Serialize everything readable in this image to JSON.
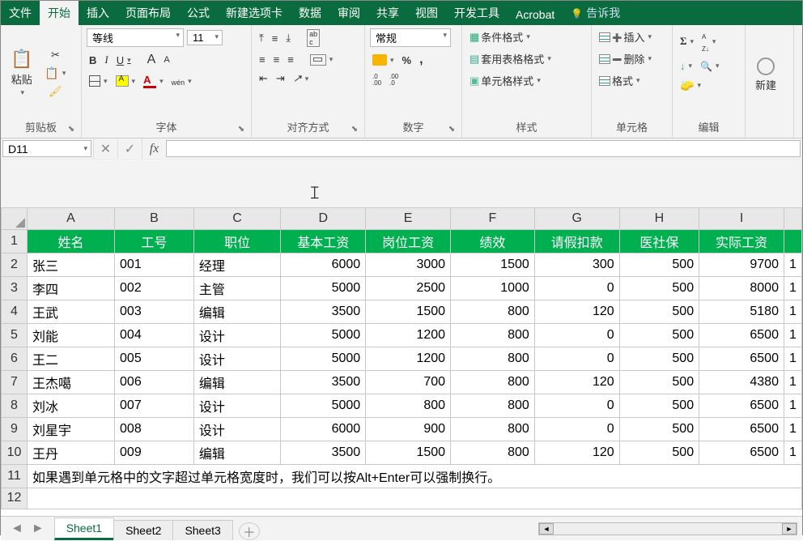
{
  "tabs": {
    "file": "文件",
    "home": "开始",
    "insert": "插入",
    "pagelayout": "页面布局",
    "formulas": "公式",
    "newtab": "新建选项卡",
    "data": "数据",
    "review": "审阅",
    "share": "共享",
    "view": "视图",
    "dev": "开发工具",
    "acrobat": "Acrobat",
    "tellme": "告诉我"
  },
  "ribbon": {
    "clipboard": {
      "label": "剪贴板",
      "paste": "粘贴"
    },
    "font": {
      "label": "字体",
      "name": "等线",
      "size": "11",
      "bold": "B",
      "italic": "I",
      "underline": "U",
      "grow": "A",
      "shrink": "A"
    },
    "align": {
      "label": "对齐方式"
    },
    "number": {
      "label": "数字",
      "format": "常规"
    },
    "styles": {
      "label": "样式",
      "cond": "条件格式",
      "table": "套用表格格式",
      "cell": "单元格样式"
    },
    "cells": {
      "label": "单元格",
      "insert": "插入",
      "delete": "删除",
      "format": "格式"
    },
    "editing": {
      "label": "编辑"
    },
    "newq": {
      "label": "新建"
    }
  },
  "namebox": "D11",
  "columns": {
    "A": "A",
    "B": "B",
    "C": "C",
    "D": "D",
    "E": "E",
    "F": "F",
    "G": "G",
    "H": "H",
    "I": "I"
  },
  "headers": {
    "name": "姓名",
    "id": "工号",
    "title": "职位",
    "base": "基本工资",
    "post": "岗位工资",
    "perf": "绩效",
    "leave": "请假扣款",
    "ins": "医社保",
    "net": "实际工资"
  },
  "rows": [
    {
      "n": "2",
      "name": "张三",
      "id": "001",
      "title": "经理",
      "base": "6000",
      "post": "3000",
      "perf": "1500",
      "leave": "300",
      "ins": "500",
      "net": "9700"
    },
    {
      "n": "3",
      "name": "李四",
      "id": "002",
      "title": "主管",
      "base": "5000",
      "post": "2500",
      "perf": "1000",
      "leave": "0",
      "ins": "500",
      "net": "8000"
    },
    {
      "n": "4",
      "name": "王武",
      "id": "003",
      "title": "编辑",
      "base": "3500",
      "post": "1500",
      "perf": "800",
      "leave": "120",
      "ins": "500",
      "net": "5180"
    },
    {
      "n": "5",
      "name": "刘能",
      "id": "004",
      "title": "设计",
      "base": "5000",
      "post": "1200",
      "perf": "800",
      "leave": "0",
      "ins": "500",
      "net": "6500"
    },
    {
      "n": "6",
      "name": "王二",
      "id": "005",
      "title": "设计",
      "base": "5000",
      "post": "1200",
      "perf": "800",
      "leave": "0",
      "ins": "500",
      "net": "6500"
    },
    {
      "n": "7",
      "name": "王杰噶",
      "id": "006",
      "title": "编辑",
      "base": "3500",
      "post": "700",
      "perf": "800",
      "leave": "120",
      "ins": "500",
      "net": "4380"
    },
    {
      "n": "8",
      "name": "刘冰",
      "id": "007",
      "title": "设计",
      "base": "5000",
      "post": "800",
      "perf": "800",
      "leave": "0",
      "ins": "500",
      "net": "6500"
    },
    {
      "n": "9",
      "name": "刘星宇",
      "id": "008",
      "title": "设计",
      "base": "6000",
      "post": "900",
      "perf": "800",
      "leave": "0",
      "ins": "500",
      "net": "6500"
    },
    {
      "n": "10",
      "name": "王丹",
      "id": "009",
      "title": "编辑",
      "base": "3500",
      "post": "1500",
      "perf": "800",
      "leave": "120",
      "ins": "500",
      "net": "6500"
    }
  ],
  "note_row": "11",
  "note": "如果遇到单元格中的文字超过单元格宽度时，我们可以按Alt+Enter可以强制换行。",
  "empty_row": "12",
  "sheets": {
    "s1": "Sheet1",
    "s2": "Sheet2",
    "s3": "Sheet3"
  }
}
